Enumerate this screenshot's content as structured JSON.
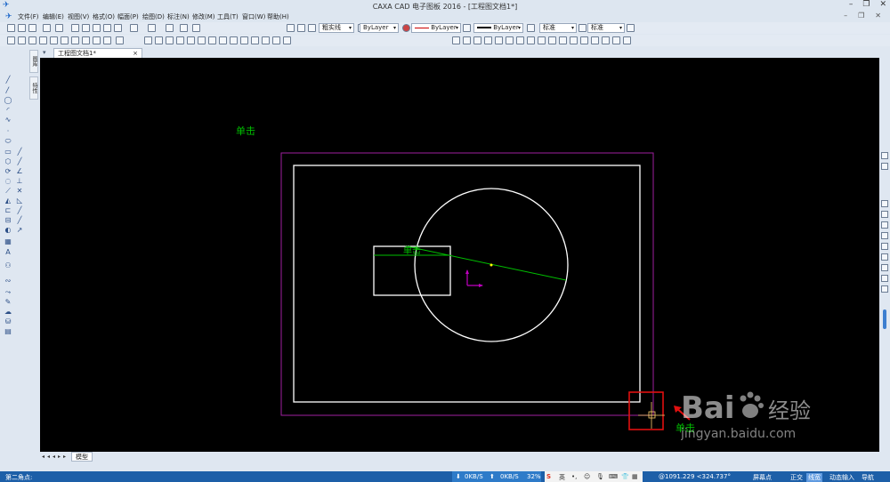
{
  "window": {
    "title": "CAXA CAD 电子图板 2016 - [工程图文档1*]"
  },
  "menu": [
    "文件(F)",
    "编辑(E)",
    "视图(V)",
    "格式(O)",
    "幅面(P)",
    "绘图(D)",
    "标注(N)",
    "修改(M)",
    "工具(T)",
    "窗口(W)",
    "帮助(H)"
  ],
  "toolbar": {
    "linetype_combo": "粗实线",
    "layer_combo": "ByLayer",
    "linestyle_combo": "ByLayer",
    "lineweight_combo": "ByLayer",
    "text_style_combo": "标准",
    "dim_style_combo": "标准"
  },
  "tabs": {
    "document": "工程图文档1*",
    "side_tab_1": "图库",
    "side_tab_2": "特性"
  },
  "layout_tabs": {
    "model": "模型"
  },
  "canvas": {
    "annotation_top": "单击",
    "annotation_rect": "单击",
    "annotation_bottom": "单击"
  },
  "status": {
    "prompt": "第二角点:",
    "net_up": "0KB/S",
    "net_down": "0KB/S",
    "net_percent": "32%",
    "ime_mode": "英",
    "coords": "@1091.229 <324.737°",
    "snap_mode": "屏幕点",
    "ortho": "正交",
    "linewidth": "线宽",
    "dynamic_input": "动态输入",
    "navigation": "导航"
  },
  "watermark": {
    "brand": "Bai",
    "brand_suffix": "经验",
    "url": "jingyan.baidu.com"
  },
  "colors": {
    "canvas": "#000000",
    "frame": "#a020a0",
    "drawing": "#ffffff",
    "accent_green": "#00c000",
    "highlight_red": "#e01010",
    "status": "#1d5fa8"
  }
}
